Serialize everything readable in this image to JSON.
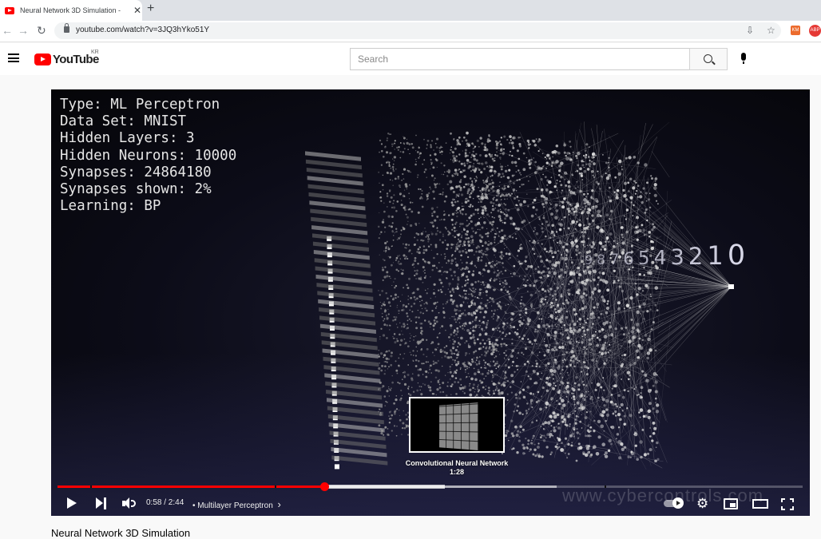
{
  "browser": {
    "tab_title": "Neural Network 3D Simulation -",
    "tab_close": "✕",
    "new_tab": "+",
    "url": "youtube.com/watch?v=3JQ3hYko51Y",
    "ext1_label": "KM",
    "ext2_label": "ABP"
  },
  "youtube": {
    "logo_text": "YouTube",
    "region": "KR",
    "search_placeholder": "Search"
  },
  "video": {
    "overlay_lines": [
      "Type: ML Perceptron",
      "Data Set: MNIST",
      "Hidden Layers: 3",
      "Hidden Neurons: 10000",
      "Synapses: 24864180",
      "Synapses shown: 2%",
      "Learning: BP"
    ],
    "output_digits": [
      "9",
      "8",
      "7",
      "6",
      "5",
      "4",
      "3",
      "2",
      "1",
      "0"
    ],
    "watermark": "www.cybercontrols.com",
    "preview_chapter": "Convolutional Neural Network",
    "preview_time": "1:28",
    "current_time": "0:58",
    "duration": "2:44",
    "time_display": "0:58 / 2:44",
    "chapter_title": "• Multilayer Perceptron",
    "chapter_chevron": "›",
    "played_fraction": 0.358,
    "buffered_fraction": 0.67,
    "hover_fraction": 0.52,
    "chapter_markers": [
      0.044,
      0.292,
      0.734
    ],
    "progress_color": "#ff0000"
  },
  "page": {
    "video_title": "Neural Network 3D Simulation"
  }
}
